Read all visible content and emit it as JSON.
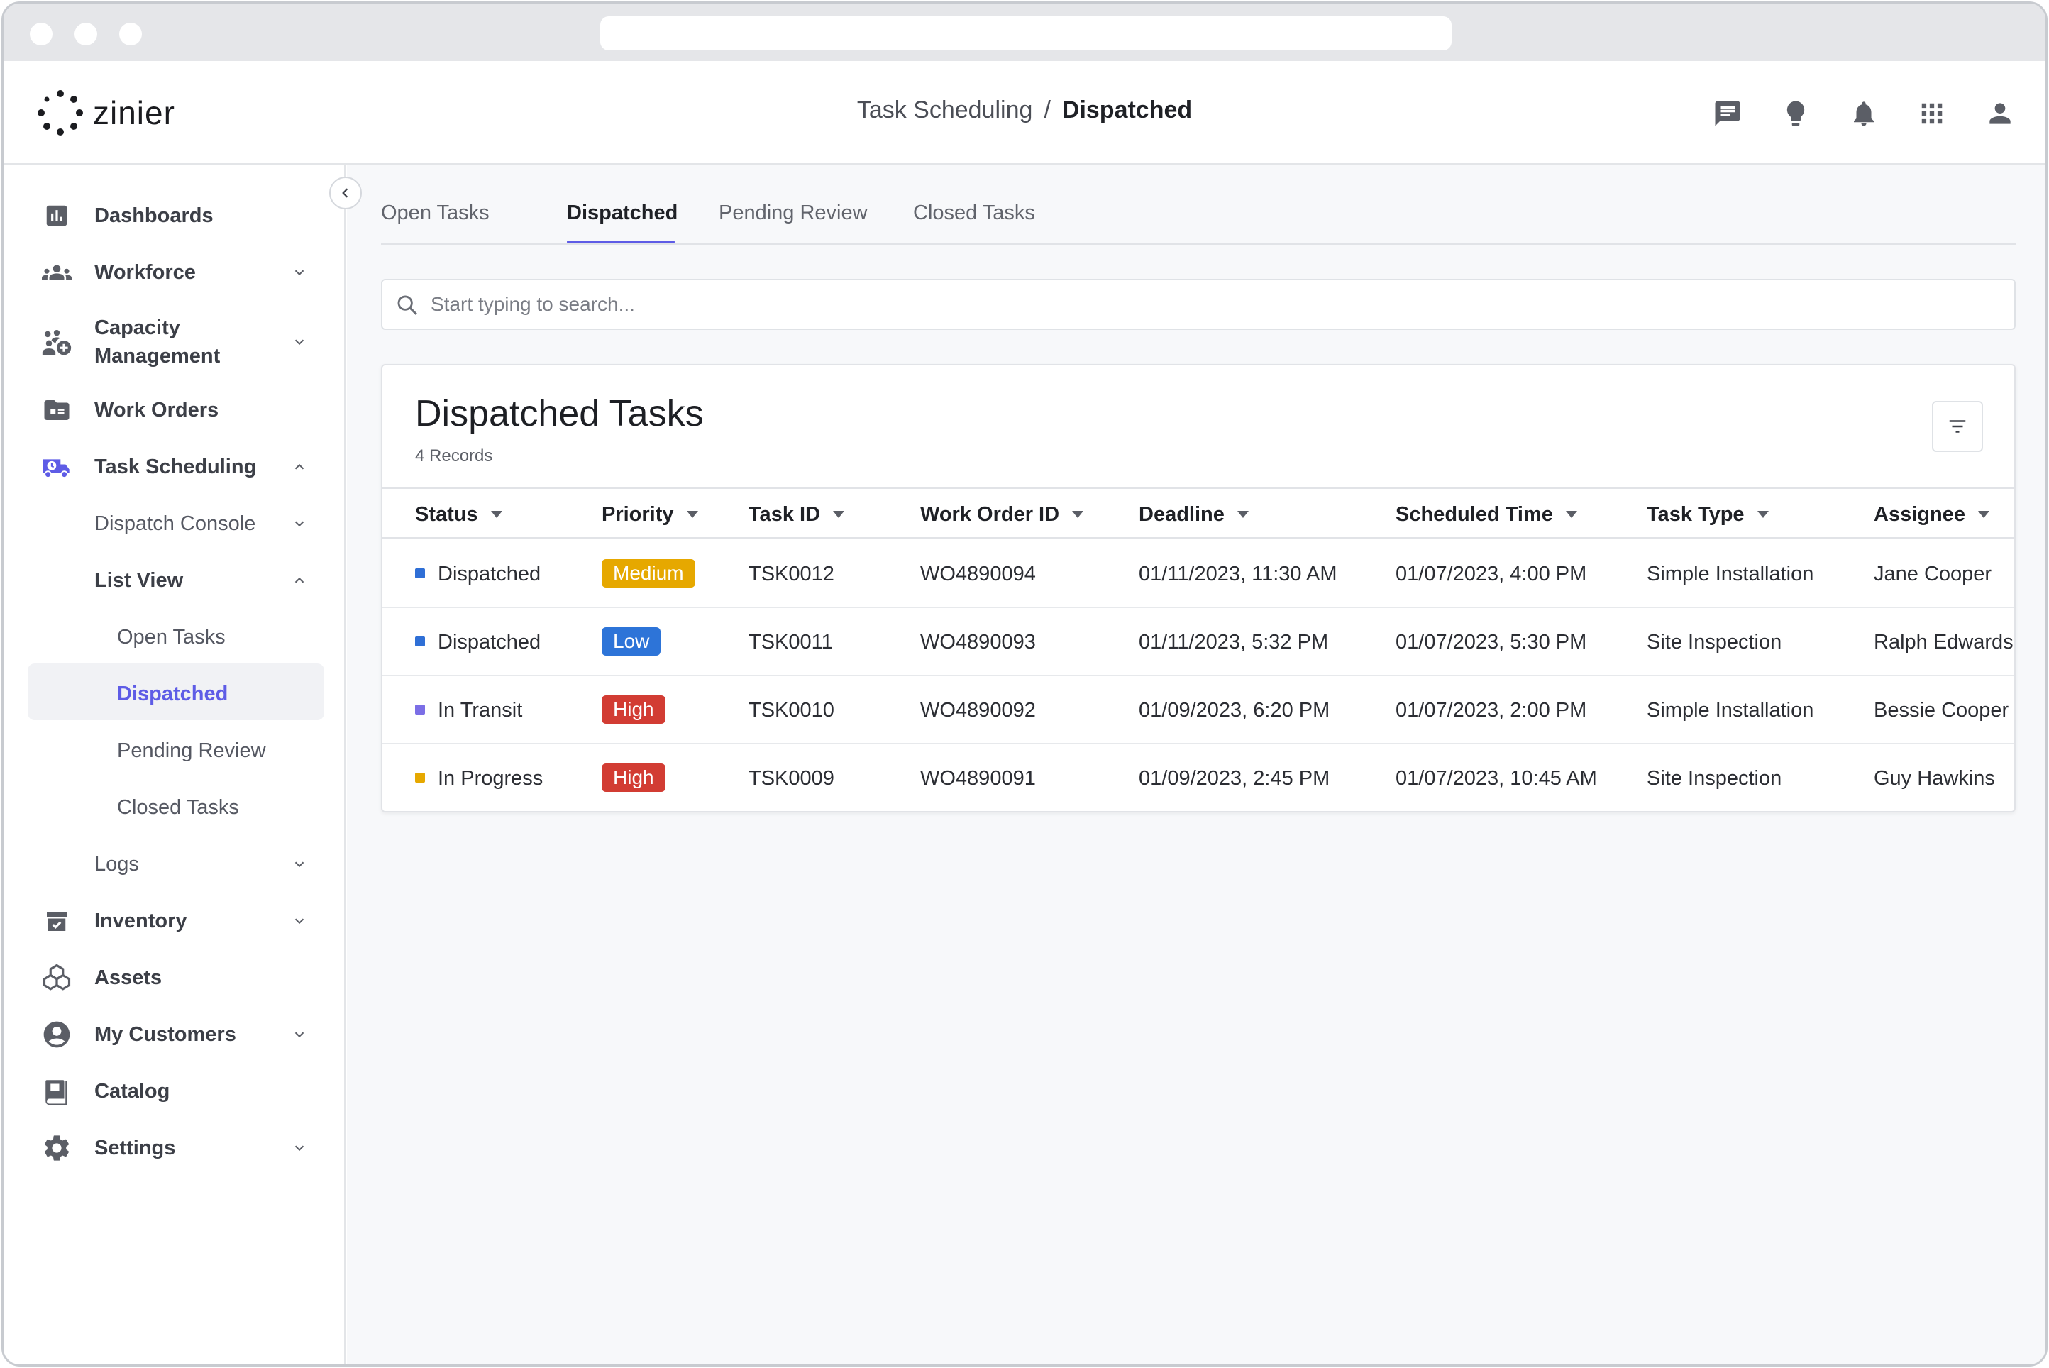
{
  "app": {
    "logo_text": "zinier"
  },
  "breadcrumb": {
    "parent": "Task Scheduling",
    "separator": "/",
    "current": "Dispatched"
  },
  "top_icons": [
    "chat-icon",
    "lightbulb-icon",
    "bell-icon",
    "apps-grid-icon",
    "user-icon"
  ],
  "sidebar": {
    "items": [
      {
        "label": "Dashboards",
        "icon": "dashboard-icon"
      },
      {
        "label": "Workforce",
        "icon": "people-icon",
        "chevron": "down"
      },
      {
        "label": "Capacity\nManagement",
        "icon": "capacity-icon",
        "chevron": "down"
      },
      {
        "label": "Work Orders",
        "icon": "work-orders-icon"
      },
      {
        "label": "Task Scheduling",
        "icon": "truck-clock-icon",
        "chevron": "up"
      },
      {
        "label": "Dispatch Console",
        "chevron": "down"
      },
      {
        "label": "List View",
        "chevron": "up"
      },
      {
        "label": "Open Tasks"
      },
      {
        "label": "Dispatched",
        "active": true
      },
      {
        "label": "Pending Review"
      },
      {
        "label": "Closed Tasks"
      },
      {
        "label": "Logs",
        "chevron": "down"
      },
      {
        "label": "Inventory",
        "icon": "inventory-icon",
        "chevron": "down"
      },
      {
        "label": "Assets",
        "icon": "assets-icon"
      },
      {
        "label": "My Customers",
        "icon": "customer-icon",
        "chevron": "down"
      },
      {
        "label": "Catalog",
        "icon": "catalog-icon"
      },
      {
        "label": "Settings",
        "icon": "settings-icon",
        "chevron": "down"
      }
    ]
  },
  "tabs": [
    {
      "label": "Open Tasks"
    },
    {
      "label": "Dispatched",
      "active": true
    },
    {
      "label": "Pending Review"
    },
    {
      "label": "Closed Tasks"
    }
  ],
  "search": {
    "placeholder": "Start typing to search..."
  },
  "table": {
    "title": "Dispatched Tasks",
    "records": "4 Records",
    "columns": [
      "Status",
      "Priority",
      "Task ID",
      "Work Order ID",
      "Deadline",
      "Scheduled Time",
      "Task Type",
      "Assignee"
    ],
    "rows": [
      {
        "status": "Dispatched",
        "status_color": "#2f6fd6",
        "priority": "Medium",
        "priority_color": "#e6a800",
        "task_id": "TSK0012",
        "work_order_id": "WO4890094",
        "deadline": "01/11/2023, 11:30 AM",
        "scheduled": "01/07/2023, 4:00 PM",
        "task_type": "Simple Installation",
        "assignee": "Jane Cooper"
      },
      {
        "status": "Dispatched",
        "status_color": "#2f6fd6",
        "priority": "Low",
        "priority_color": "#2d74d8",
        "task_id": "TSK0011",
        "work_order_id": "WO4890093",
        "deadline": "01/11/2023, 5:32 PM",
        "scheduled": "01/07/2023, 5:30 PM",
        "task_type": "Site Inspection",
        "assignee": "Ralph Edwards"
      },
      {
        "status": "In Transit",
        "status_color": "#7b6ee6",
        "priority": "High",
        "priority_color": "#d23c33",
        "task_id": "TSK0010",
        "work_order_id": "WO4890092",
        "deadline": "01/09/2023, 6:20 PM",
        "scheduled": "01/07/2023, 2:00 PM",
        "task_type": "Simple Installation",
        "assignee": "Bessie Cooper"
      },
      {
        "status": "In Progress",
        "status_color": "#e6a800",
        "priority": "High",
        "priority_color": "#d23c33",
        "task_id": "TSK0009",
        "work_order_id": "WO4890091",
        "deadline": "01/09/2023, 2:45 PM",
        "scheduled": "01/07/2023, 10:45 AM",
        "task_type": "Site Inspection",
        "assignee": "Guy Hawkins"
      }
    ]
  },
  "colors": {
    "accent": "#5e5ce6",
    "icon": "#5b5e66",
    "active_nav_icon": "#5e5ce6"
  }
}
